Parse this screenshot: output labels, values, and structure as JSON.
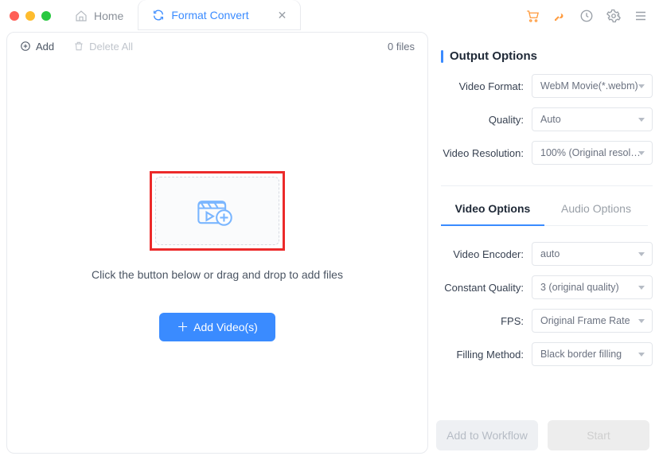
{
  "tabs": {
    "home": "Home",
    "active": "Format Convert"
  },
  "toolbar": {
    "add": "Add",
    "delete_all": "Delete All",
    "file_count": "0 files"
  },
  "dropzone": {
    "hint": "Click the button below or drag and drop to add files",
    "add_videos": "Add Video(s)"
  },
  "output": {
    "title": "Output Options",
    "fields": {
      "video_format": {
        "label": "Video Format:",
        "value": "WebM Movie(*.webm)"
      },
      "quality": {
        "label": "Quality:",
        "value": "Auto"
      },
      "resolution": {
        "label": "Video Resolution:",
        "value": "100% (Original resol…"
      }
    }
  },
  "subtabs": {
    "video": "Video Options",
    "audio": "Audio Options"
  },
  "video_options": {
    "encoder": {
      "label": "Video Encoder:",
      "value": "auto"
    },
    "cq": {
      "label": "Constant Quality:",
      "value": "3 (original quality)"
    },
    "fps": {
      "label": "FPS:",
      "value": "Original Frame Rate"
    },
    "fill": {
      "label": "Filling Method:",
      "value": "Black border filling"
    }
  },
  "actions": {
    "workflow": "Add to Workflow",
    "start": "Start"
  }
}
